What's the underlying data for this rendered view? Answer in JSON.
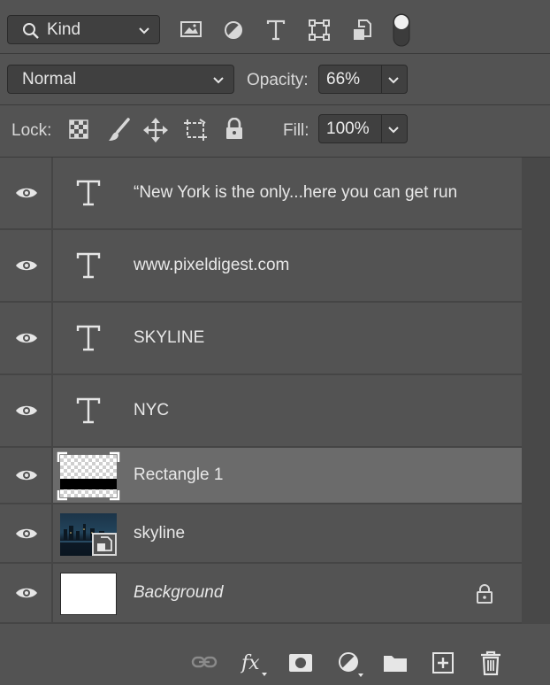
{
  "filter": {
    "kind_label": "Kind",
    "icons": [
      "image-filter-icon",
      "adjustment-filter-icon",
      "type-filter-icon",
      "shape-filter-icon",
      "smart-object-filter-icon",
      "filter-toggle-icon"
    ]
  },
  "blend": {
    "mode": "Normal",
    "opacity_label": "Opacity:",
    "opacity_value": "66%"
  },
  "lock": {
    "label": "Lock:",
    "fill_label": "Fill:",
    "fill_value": "100%"
  },
  "layers": [
    {
      "name": "“New York is the only...here you can get run",
      "type": "text"
    },
    {
      "name": "www.pixeldigest.com",
      "type": "text"
    },
    {
      "name": "SKYLINE",
      "type": "text"
    },
    {
      "name": "NYC",
      "type": "text"
    },
    {
      "name": "Rectangle 1",
      "type": "shape",
      "selected": true
    },
    {
      "name": "skyline",
      "type": "smart-object"
    },
    {
      "name": "Background",
      "type": "background",
      "locked": true
    }
  ],
  "bottom_icons": [
    "link-icon",
    "fx-icon",
    "mask-icon",
    "adjustment-icon",
    "folder-icon",
    "new-layer-icon",
    "trash-icon"
  ],
  "colors": {
    "panel": "#535353",
    "field": "#404040",
    "selected": "#6b6b6b"
  }
}
